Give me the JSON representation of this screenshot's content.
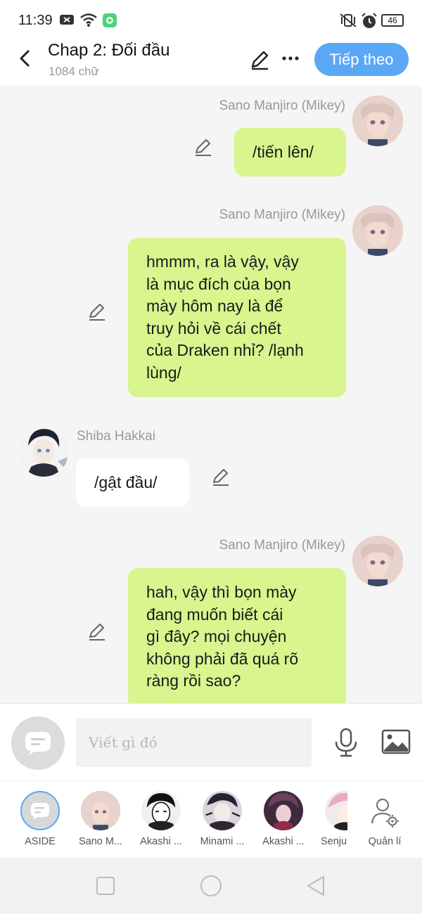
{
  "status": {
    "time": "11:39",
    "battery": "46",
    "icons": [
      "close-notification-icon",
      "wifi-icon",
      "app-notification-icon",
      "vibrate-icon",
      "alarm-icon",
      "battery-icon"
    ]
  },
  "header": {
    "title": "Chap 2: Đối đầu",
    "word_count": "1084 chữ",
    "next_label": "Tiếp theo"
  },
  "messages": [
    {
      "side": "right",
      "sender": "Sano Manjiro (Mikey)",
      "lines": [
        "/tiến lên/"
      ]
    },
    {
      "side": "right",
      "sender": "Sano Manjiro (Mikey)",
      "lines": [
        "hmmm, ra là vậy, vậy",
        "là mục đích của bọn",
        "mày hôm nay là để",
        "truy hỏi về cái chết",
        "của Draken nhỉ? /lạnh",
        "lùng/"
      ]
    },
    {
      "side": "left",
      "sender": "Shiba Hakkai",
      "lines": [
        "/gật đầu/"
      ]
    },
    {
      "side": "right",
      "sender": "Sano Manjiro (Mikey)",
      "lines": [
        "hah, vậy thì bọn mày",
        "đang muốn biết cái",
        "gì đây? mọi chuyện",
        "không phải đã quá rõ",
        "ràng rồi sao?"
      ]
    }
  ],
  "input": {
    "placeholder": "Viết gì đó"
  },
  "characters": [
    {
      "label": "ASIDE"
    },
    {
      "label": "Sano M..."
    },
    {
      "label": "Akashi ..."
    },
    {
      "label": "Minami ..."
    },
    {
      "label": "Akashi ..."
    },
    {
      "label": "Senju"
    }
  ],
  "manage_label": "Quản lí",
  "colors": {
    "accent": "#5aa8f5",
    "right_bubble": "#d8f58e",
    "left_bubble": "#ffffff",
    "background": "#f5f5f5"
  }
}
